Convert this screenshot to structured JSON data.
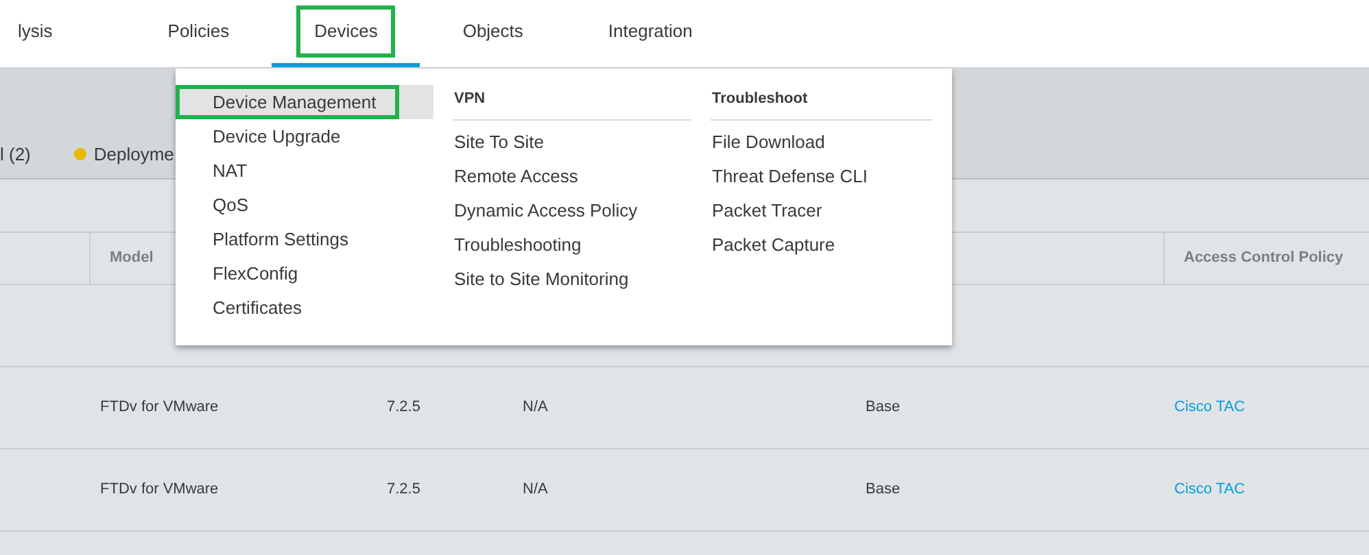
{
  "nav": {
    "tabs": [
      {
        "label": "lysis",
        "selected": false,
        "highlighted": false
      },
      {
        "label": "Policies",
        "selected": false,
        "highlighted": false
      },
      {
        "label": "Devices",
        "selected": true,
        "highlighted": true
      },
      {
        "label": "Objects",
        "selected": false,
        "highlighted": false
      },
      {
        "label": "Integration",
        "selected": false,
        "highlighted": false
      }
    ]
  },
  "toolbar": {
    "filters": [
      {
        "label": "l (2)"
      },
      {
        "label": "Deployme",
        "color": "#e6b800"
      }
    ]
  },
  "menu": {
    "columns": [
      {
        "items": [
          {
            "label": "Device Management",
            "selected": true,
            "highlighted": true
          },
          {
            "label": "Device Upgrade",
            "selected": false,
            "highlighted": false
          },
          {
            "label": "NAT",
            "selected": false,
            "highlighted": false
          },
          {
            "label": "QoS",
            "selected": false,
            "highlighted": false
          },
          {
            "label": "Platform Settings",
            "selected": false,
            "highlighted": false
          },
          {
            "label": "FlexConfig",
            "selected": false,
            "highlighted": false
          },
          {
            "label": "Certificates",
            "selected": false,
            "highlighted": false
          }
        ]
      },
      {
        "heading": "VPN",
        "items": [
          {
            "label": "Site To Site",
            "selected": false,
            "highlighted": false
          },
          {
            "label": "Remote Access",
            "selected": false,
            "highlighted": false
          },
          {
            "label": "Dynamic Access Policy",
            "selected": false,
            "highlighted": false
          },
          {
            "label": "Troubleshooting",
            "selected": false,
            "highlighted": false
          },
          {
            "label": "Site to Site Monitoring",
            "selected": false,
            "highlighted": false
          }
        ]
      },
      {
        "heading": "Troubleshoot",
        "items": [
          {
            "label": "File Download",
            "selected": false,
            "highlighted": false
          },
          {
            "label": "Threat Defense CLI",
            "selected": false,
            "highlighted": false
          },
          {
            "label": "Packet Tracer",
            "selected": false,
            "highlighted": false
          },
          {
            "label": "Packet Capture",
            "selected": false,
            "highlighted": false
          }
        ]
      }
    ]
  },
  "table": {
    "header": {
      "model": "Model",
      "access_control_policy": "Access Control Policy"
    },
    "rows": [
      {
        "model": "FTDv for VMware",
        "version": "7.2.5",
        "column_4": "N/A",
        "license": "Base",
        "access_control_policy": "Cisco TAC"
      },
      {
        "model": "FTDv for VMware",
        "version": "7.2.5",
        "column_4": "N/A",
        "license": "Base",
        "access_control_policy": "Cisco TAC"
      }
    ]
  }
}
